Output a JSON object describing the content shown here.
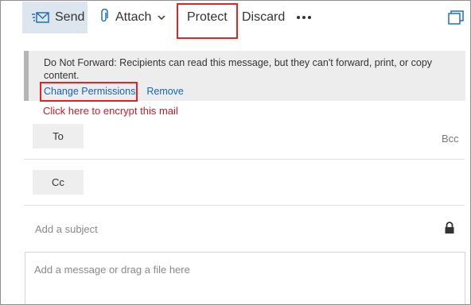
{
  "toolbar": {
    "send_label": "Send",
    "attach_label": "Attach",
    "protect_label": "Protect",
    "discard_label": "Discard"
  },
  "icons": {
    "send": "send-envelope-icon",
    "attach": "paperclip-icon",
    "dropdown": "chevron-down-icon",
    "more": "more-ellipsis-icon",
    "popout": "popout-window-icon",
    "lock": "lock-icon"
  },
  "infobar": {
    "message": "Do Not Forward: Recipients can read this message, but they can't forward, print, or copy content.",
    "change_permissions": "Change Permissions",
    "remove": "Remove"
  },
  "annotation": "Click here to encrypt this mail",
  "fields": {
    "to_label": "To",
    "cc_label": "Cc",
    "bcc_label": "Bcc",
    "subject_placeholder": "Add a subject",
    "body_placeholder": "Add a message or drag a file here"
  },
  "colors": {
    "accent": "#1b63b1",
    "highlight": "#e32424",
    "send_bg": "#dde6ef",
    "infobar_bg": "#ededed"
  }
}
